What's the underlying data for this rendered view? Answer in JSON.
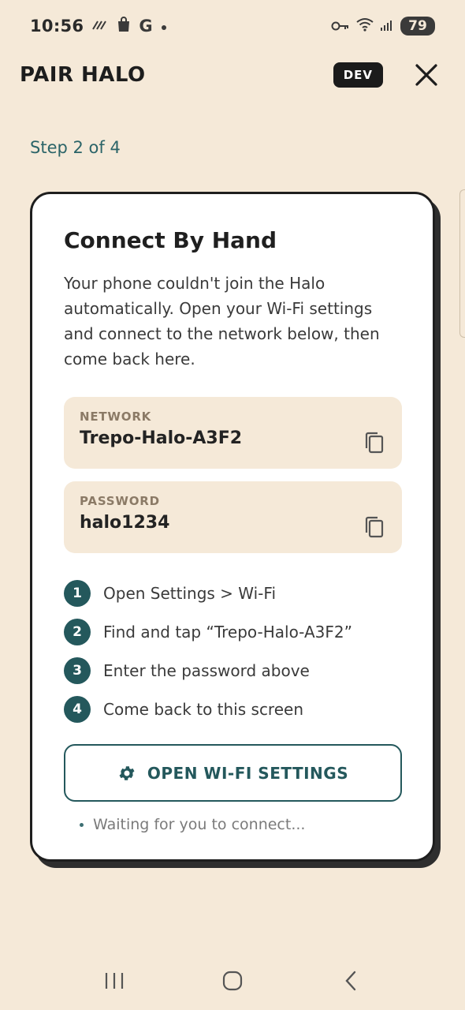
{
  "status_bar": {
    "time": "10:56",
    "notification_icons": [
      "signal-stripes-icon",
      "shopping-bag-icon",
      "google-icon",
      "dot-icon"
    ],
    "google_letter": "G",
    "battery": "79"
  },
  "header": {
    "title": "PAIR HALO",
    "dev_badge": "DEV"
  },
  "step_label": "Step 2 of 4",
  "card": {
    "title": "Connect By Hand",
    "description": "Your phone couldn't join the Halo automatically. Open your Wi-Fi settings and connect to the network below, then come back here.",
    "network": {
      "label": "NETWORK",
      "value": "Trepo-Halo-A3F2"
    },
    "password": {
      "label": "PASSWORD",
      "value": "halo1234"
    },
    "steps": [
      {
        "num": "1",
        "text": "Open Settings > Wi-Fi"
      },
      {
        "num": "2",
        "text": "Find and tap “Trepo-Halo-A3F2”"
      },
      {
        "num": "3",
        "text": "Enter the password above"
      },
      {
        "num": "4",
        "text": "Come back to this screen"
      }
    ],
    "wifi_button": "OPEN WI-FI SETTINGS",
    "waiting": "Waiting for you to connect..."
  },
  "colors": {
    "background": "#f5e9d8",
    "accent": "#24585c",
    "card": "#ffffff",
    "badge": "#1b1b1b"
  }
}
